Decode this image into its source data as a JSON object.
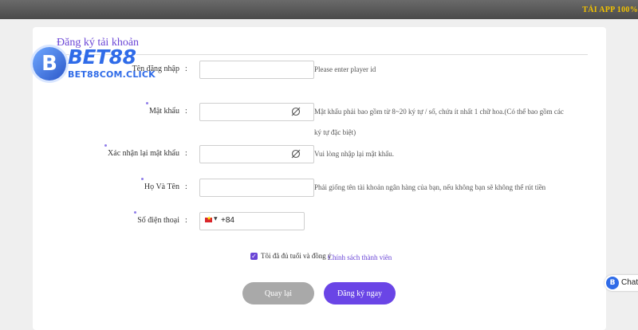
{
  "header": {
    "app_banner": "TẢI APP 100%"
  },
  "brand": {
    "logo_letter": "B",
    "logo_name": "BET88",
    "logo_domain": "BET88COM.CLICK"
  },
  "form": {
    "title": "Đăng ký tải khoản",
    "colon": ":",
    "fields": {
      "username": {
        "label": "Tên đăng nhập",
        "value": "",
        "hint": "Please enter player id"
      },
      "password": {
        "label": "Mật khẩu",
        "value": "",
        "hint_line1": "Mật khẩu phải bao gồm từ 8~20 ký tự / số, chứa ít nhất 1 chữ hoa.(Có thể bao gồm các",
        "hint_line2": "ký tự đặc biệt)",
        "icon": "eye-slash-icon"
      },
      "confirm_password": {
        "label": "Xác nhận lại mật khẩu",
        "value": "",
        "hint": "Vui lòng nhập lại mật khẩu.",
        "icon": "eye-slash-icon"
      },
      "full_name": {
        "label": "Họ Và Tên",
        "value": "",
        "hint": "Phải giống tên tài khoản ngân hàng của bạn, nếu không bạn sẽ không thể rút tiền"
      },
      "phone": {
        "label": "Số điện thoại",
        "country_flag": "vietnam-flag-icon",
        "country_code": "+84",
        "value": ""
      }
    },
    "agreement": {
      "checked": true,
      "text": "Tôi đã đủ tuổi và đồng ý",
      "link": "Chính sách thành viên"
    },
    "buttons": {
      "back": "Quay lại",
      "register": "Đăng ký ngay"
    }
  },
  "chat_widget": {
    "label": "Chat"
  },
  "colors": {
    "accent": "#6a45e6",
    "banner": "#f2c200",
    "logo": "#2f6be8",
    "back_button": "#a9a9a9"
  }
}
